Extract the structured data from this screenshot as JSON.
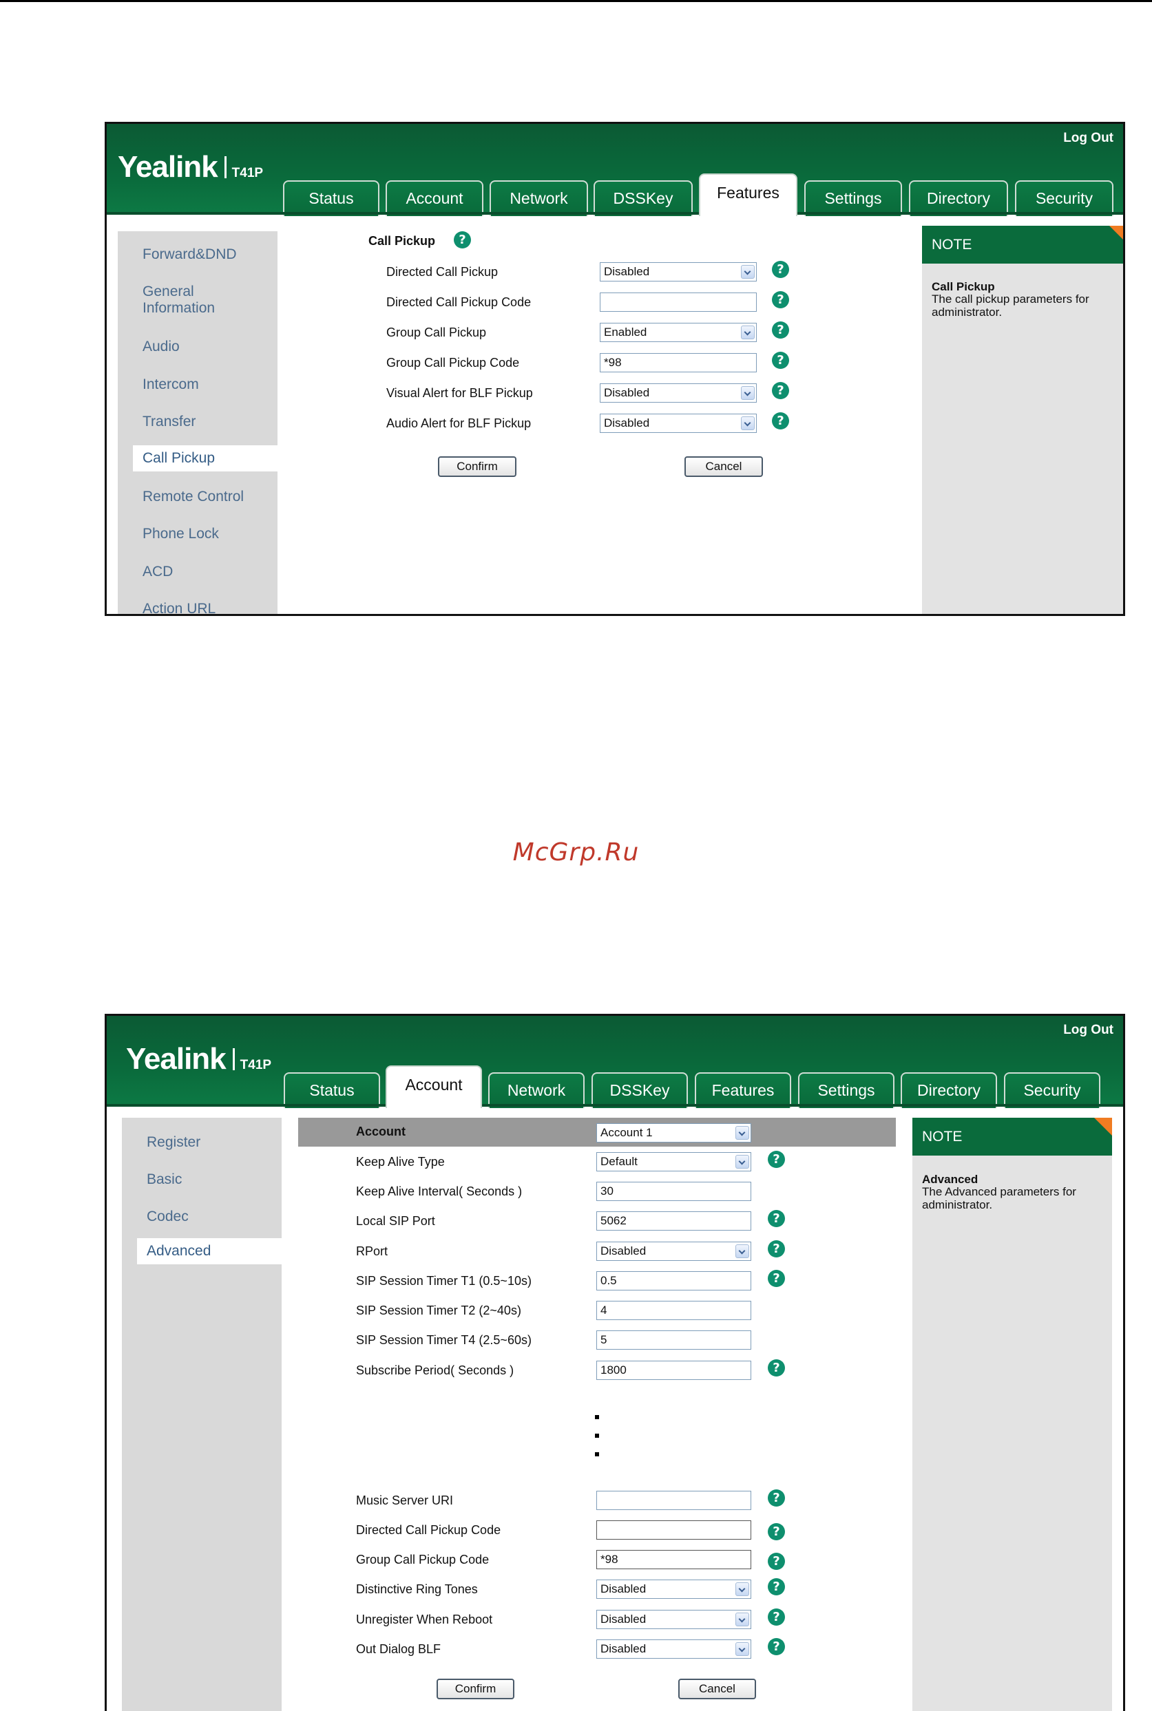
{
  "watermark": "McGrp.Ru",
  "header": {
    "logo": "Yealink",
    "model": "T41P",
    "logout": "Log Out"
  },
  "tabs": [
    "Status",
    "Account",
    "Network",
    "DSSKey",
    "Features",
    "Settings",
    "Directory",
    "Security"
  ],
  "shot1": {
    "active_tab": "Features",
    "nav": [
      "Forward&DND",
      "General Information",
      "Audio",
      "Intercom",
      "Transfer",
      "Call Pickup",
      "Remote Control",
      "Phone Lock",
      "ACD",
      "Action URL"
    ],
    "nav_active": "Call Pickup",
    "section_title": "Call Pickup",
    "fields": [
      {
        "label": "Directed Call Pickup",
        "type": "select",
        "value": "Disabled"
      },
      {
        "label": "Directed Call Pickup Code",
        "type": "input",
        "value": ""
      },
      {
        "label": "Group Call Pickup",
        "type": "select",
        "value": "Enabled"
      },
      {
        "label": "Group Call Pickup Code",
        "type": "input",
        "value": "*98"
      },
      {
        "label": "Visual Alert for BLF Pickup",
        "type": "select",
        "value": "Disabled"
      },
      {
        "label": "Audio Alert for BLF Pickup",
        "type": "select",
        "value": "Disabled"
      }
    ],
    "confirm": "Confirm",
    "cancel": "Cancel",
    "note": {
      "head": "NOTE",
      "title": "Call Pickup",
      "text": "The call pickup parameters for administrator."
    }
  },
  "shot2": {
    "active_tab": "Account",
    "nav": [
      "Register",
      "Basic",
      "Codec",
      "Advanced"
    ],
    "nav_active": "Advanced",
    "account_label": "Account",
    "account_value": "Account 1",
    "fields_top": [
      {
        "label": "Keep Alive Type",
        "type": "select",
        "value": "Default",
        "help": true
      },
      {
        "label": "Keep Alive Interval( Seconds )",
        "type": "input",
        "value": "30",
        "help": false
      },
      {
        "label": "Local SIP Port",
        "type": "input",
        "value": "5062",
        "help": true
      },
      {
        "label": "RPort",
        "type": "select",
        "value": "Disabled",
        "help": true
      },
      {
        "label": "SIP Session Timer T1 (0.5~10s)",
        "type": "input",
        "value": "0.5",
        "help": true
      },
      {
        "label": "SIP Session Timer T2 (2~40s)",
        "type": "input",
        "value": "4",
        "help": false
      },
      {
        "label": "SIP Session Timer T4 (2.5~60s)",
        "type": "input",
        "value": "5",
        "help": false
      },
      {
        "label": "Subscribe Period( Seconds )",
        "type": "input",
        "value": "1800",
        "help": true
      }
    ],
    "fields_bottom": [
      {
        "label": "Music Server URI",
        "type": "input",
        "value": "",
        "help": true
      },
      {
        "label": "Directed Call Pickup Code",
        "type": "input",
        "value": "",
        "help": true
      },
      {
        "label": "Group Call Pickup Code",
        "type": "input",
        "value": "*98",
        "help": true
      },
      {
        "label": "Distinctive Ring Tones",
        "type": "select",
        "value": "Disabled",
        "help": true
      },
      {
        "label": "Unregister When Reboot",
        "type": "select",
        "value": "Disabled",
        "help": true
      },
      {
        "label": "Out Dialog BLF",
        "type": "select",
        "value": "Disabled",
        "help": true
      }
    ],
    "confirm": "Confirm",
    "cancel": "Cancel",
    "note": {
      "head": "NOTE",
      "title": "Advanced",
      "text": "The Advanced parameters for administrator."
    }
  },
  "colors": {
    "header_green": "#0a6b3c",
    "nav_text": "#4a6a8c",
    "help_teal": "#0e8f6e",
    "note_corner": "#f07c22"
  },
  "icons": {
    "help": "question-circle-icon",
    "dropdown": "chevron-down-icon"
  }
}
